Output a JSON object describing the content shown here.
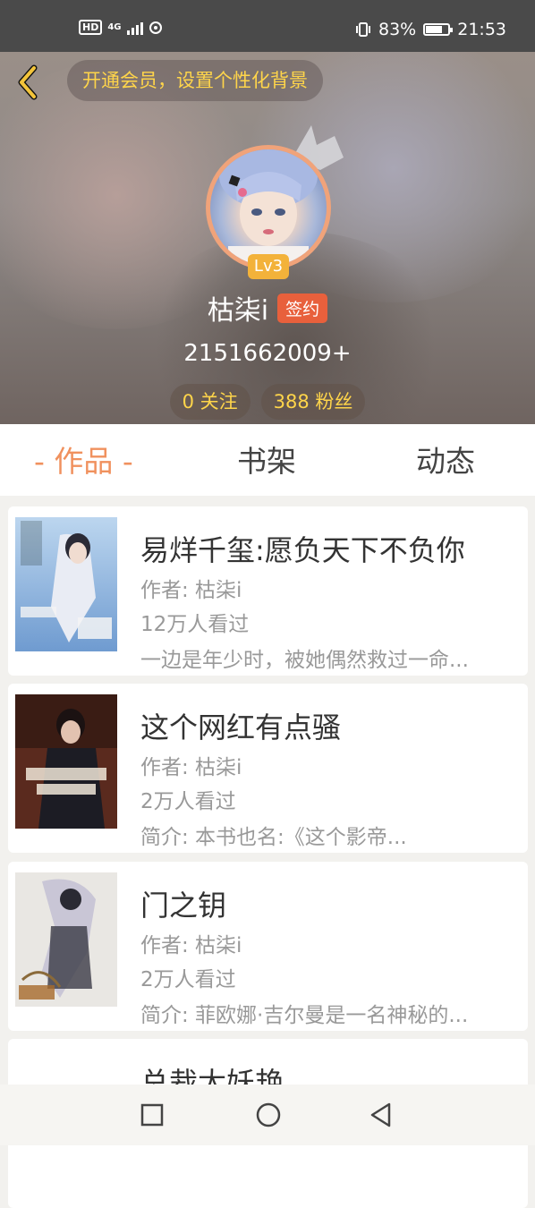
{
  "status_bar": {
    "hd_label": "HD",
    "network_label": "4G",
    "battery_percent": "83%",
    "battery_level": 0.83,
    "time": "21:53"
  },
  "header": {
    "vip_banner": "开通会员，设置个性化背景"
  },
  "profile": {
    "level": "Lv3",
    "username": "枯柒i",
    "signed_badge": "签约",
    "user_id": "2151662009+",
    "following": "0 关注",
    "followers": "388 粉丝"
  },
  "tabs": [
    {
      "label": "- 作品 -",
      "active": true
    },
    {
      "label": "书架",
      "active": false
    },
    {
      "label": "动态",
      "active": false
    }
  ],
  "books": [
    {
      "title": "易烊千玺:愿负天下不负你",
      "author": "作者: 枯柒i",
      "reads": "12万人看过",
      "desc": "一边是年少时，被她偶然救过一命..."
    },
    {
      "title": "这个网红有点骚",
      "author": "作者: 枯柒i",
      "reads": "2万人看过",
      "desc": "简介: 本书也名:《这个影帝..."
    },
    {
      "title": "门之钥",
      "author": "作者: 枯柒i",
      "reads": "2万人看过",
      "desc": "简介: 菲欧娜·吉尔曼是一名神秘的..."
    },
    {
      "title": "总裁太妖艳",
      "author": "",
      "reads": "",
      "desc": ""
    }
  ],
  "colors": {
    "accent": "#f0915e",
    "vip_text": "#ffd54a",
    "signed_bg": "#e8603c",
    "level_bg": "#f3b23a"
  }
}
